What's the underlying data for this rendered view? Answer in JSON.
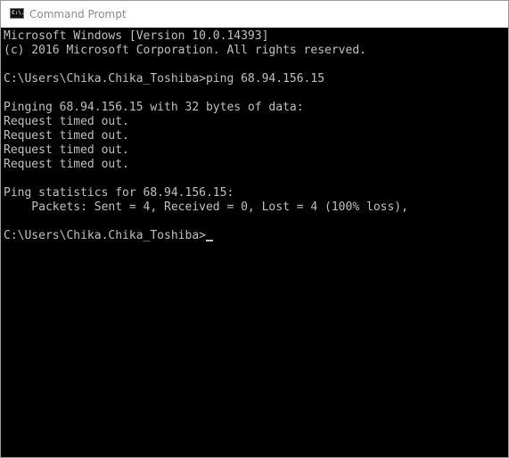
{
  "window": {
    "title": "Command Prompt",
    "icon": "cmd-icon",
    "icon_glyph": "C:\\.",
    "colors": {
      "background": "#000000",
      "text": "#c0c0c0",
      "titlebar": "#ffffff",
      "title_text": "#8a8a8a"
    }
  },
  "console": {
    "lines": [
      "Microsoft Windows [Version 10.0.14393]",
      "(c) 2016 Microsoft Corporation. All rights reserved.",
      "",
      "C:\\Users\\Chika.Chika_Toshiba>ping 68.94.156.15",
      "",
      "Pinging 68.94.156.15 with 32 bytes of data:",
      "Request timed out.",
      "Request timed out.",
      "Request timed out.",
      "Request timed out.",
      "",
      "Ping statistics for 68.94.156.15:",
      "    Packets: Sent = 4, Received = 0, Lost = 4 (100% loss),",
      "",
      "C:\\Users\\Chika.Chika_Toshiba>"
    ]
  }
}
